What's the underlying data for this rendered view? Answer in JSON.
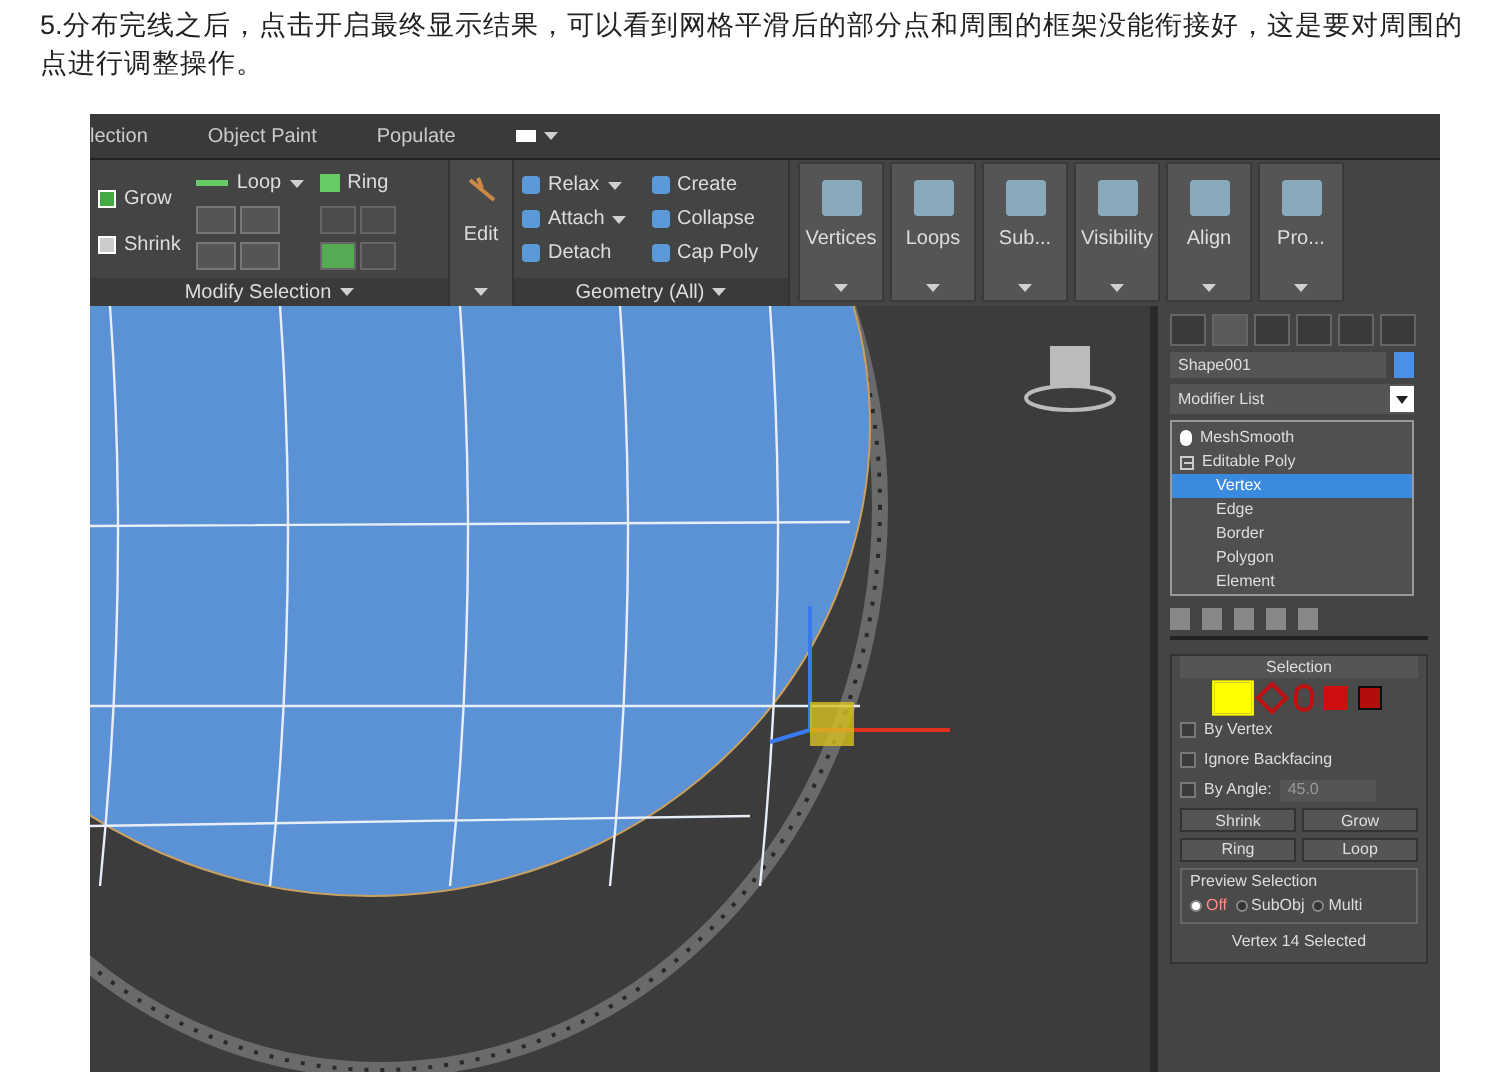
{
  "instruction": "5.分布完线之后，点击开启最终显示结果，可以看到网格平滑后的部分点和周围的框架没能衔接好，这是要对周围的点进行调整操作。",
  "ribbon_tabs": [
    "lection",
    "Object Paint",
    "Populate"
  ],
  "modify_selection": {
    "grow": "Grow",
    "shrink": "Shrink",
    "loop": "Loop",
    "ring": "Ring",
    "label": "Modify Selection"
  },
  "edit": {
    "label": "Edit"
  },
  "geometry": {
    "label": "Geometry (All)",
    "items": [
      {
        "label": "Relax",
        "dropdown": true
      },
      {
        "label": "Attach",
        "dropdown": true
      },
      {
        "label": "Detach",
        "dropdown": false
      },
      {
        "label": "Create",
        "dropdown": false
      },
      {
        "label": "Collapse",
        "dropdown": false
      },
      {
        "label": "Cap Poly",
        "dropdown": false
      }
    ]
  },
  "tools": [
    "Vertices",
    "Loops",
    "Sub...",
    "Visibility",
    "Align",
    "Pro..."
  ],
  "command_panel": {
    "object_name": "Shape001",
    "modifier_list": "Modifier List",
    "stack": [
      {
        "label": "MeshSmooth",
        "selected": false
      },
      {
        "label": "Editable Poly",
        "selected": false,
        "expanded": true,
        "children": [
          {
            "label": "Vertex",
            "selected": true
          },
          {
            "label": "Edge",
            "selected": false
          },
          {
            "label": "Border",
            "selected": false
          },
          {
            "label": "Polygon",
            "selected": false
          },
          {
            "label": "Element",
            "selected": false
          }
        ]
      }
    ],
    "selection": {
      "title": "Selection",
      "levels": [
        {
          "kind": "vertex",
          "selected": true
        },
        {
          "kind": "edge",
          "selected": false
        },
        {
          "kind": "border",
          "selected": false
        },
        {
          "kind": "polygon",
          "selected": false
        },
        {
          "kind": "element",
          "selected": false
        }
      ],
      "checkboxes": [
        {
          "label": "By Vertex",
          "checked": false
        },
        {
          "label": "Ignore Backfacing",
          "checked": false
        },
        {
          "label": "By Angle:",
          "checked": false,
          "value": "45.0"
        }
      ],
      "buttons": [
        "Shrink",
        "Grow"
      ],
      "spinners": [
        "Ring",
        "Loop"
      ],
      "preview": {
        "title": "Preview Selection",
        "options": [
          {
            "label": "Off",
            "selected": true
          },
          {
            "label": "SubObj",
            "selected": false
          },
          {
            "label": "Multi",
            "selected": false
          }
        ]
      },
      "status": "Vertex 14 Selected"
    }
  }
}
